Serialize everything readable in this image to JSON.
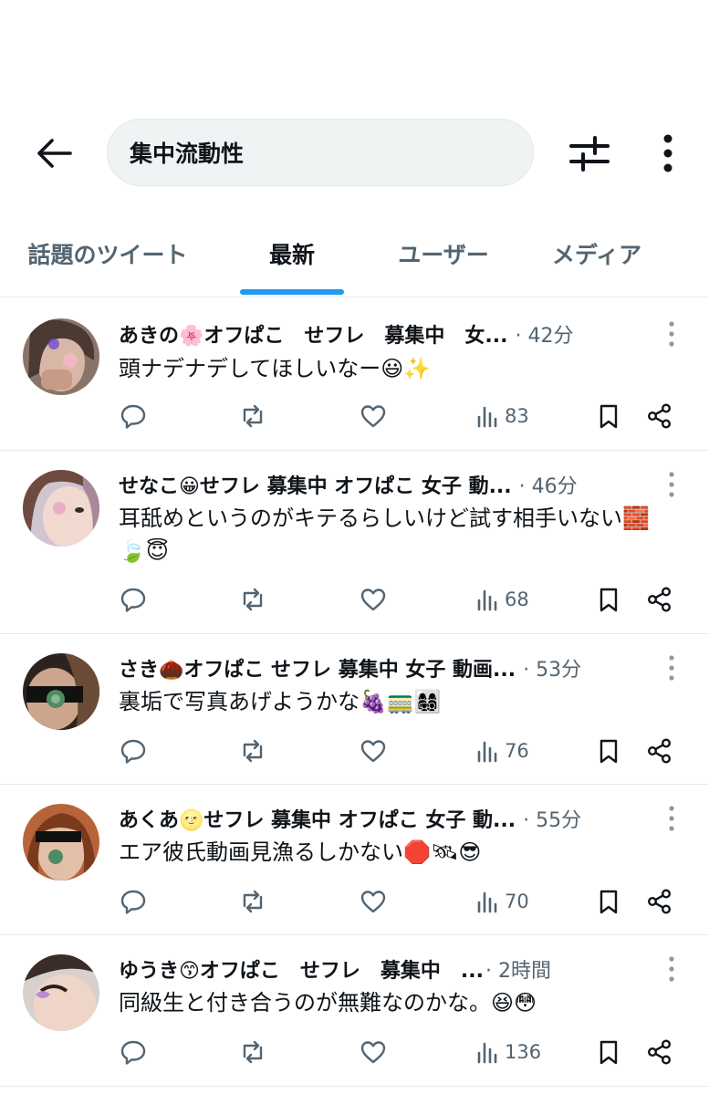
{
  "search": {
    "query": "集中流動性"
  },
  "tabs": [
    {
      "label": "話題のツイート"
    },
    {
      "label": "最新"
    },
    {
      "label": "ユーザー"
    },
    {
      "label": "メディア"
    }
  ],
  "active_tab": "最新",
  "tweets": [
    {
      "name": "あきの🌸オフぱこ　せフレ　募集中　女...",
      "time": "· 42分",
      "text": "頭ナデナデしてほしいなー😃✨",
      "views": "83"
    },
    {
      "name": "せなこ😀せフレ 募集中 オフぱこ 女子 動...",
      "time": "· 46分",
      "text": "耳舐めというのがキテるらしいけど試す相手いない🧱🍃😇",
      "views": "68"
    },
    {
      "name": "さき🌰オフぱこ せフレ 募集中 女子 動画...",
      "time": "· 53分",
      "text": "裏垢で写真あげようかな🍇🚃👩‍👩‍👧‍👦",
      "views": "76"
    },
    {
      "name": "あくあ🌝せフレ 募集中 オフぱこ 女子 動...",
      "time": "· 55分",
      "text": "エア彼氏動画見漁るしかない🛑🛰😎",
      "views": "70"
    },
    {
      "name": "ゆうき😙オフぱこ　せフレ　募集中　...",
      "time": "· 2時間",
      "text": "同級生と付き合うのが無難なのかな。😆😳",
      "views": "136"
    }
  ],
  "colors": {
    "accent": "#1d9bf0",
    "text": "#0f1419",
    "muted": "#536471",
    "divider": "#e6e9eb"
  }
}
